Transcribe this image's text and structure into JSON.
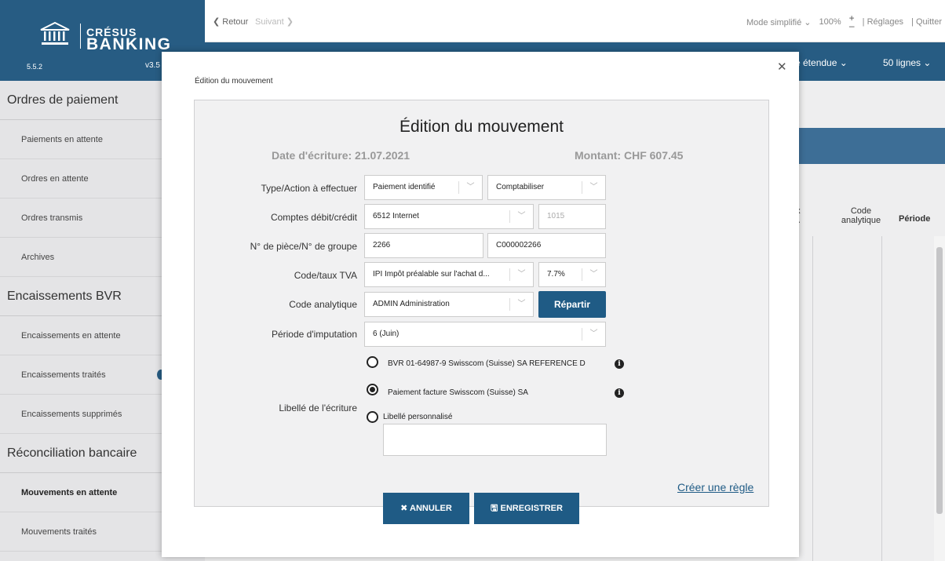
{
  "app": {
    "brand_top": "CRÉSUS",
    "brand_bottom": "BANKING",
    "version_left": "5.5.2",
    "version_right": "v3.5"
  },
  "topbar": {
    "back": "❮ Retour",
    "next": "Suivant ❯",
    "mode": "Mode simplifié ⌄",
    "zoom": "100%",
    "zoom_plus": "+",
    "zoom_minus": "–",
    "settings": "| Réglages",
    "quit": "| Quitter"
  },
  "navband": {
    "view": "e étendue ⌄",
    "lines": "50 lignes ⌄"
  },
  "sidebar": {
    "sections": [
      {
        "title": "Ordres de paiement",
        "items": [
          "Paiements en attente",
          "Ordres en attente",
          "Ordres transmis",
          "Archives"
        ]
      },
      {
        "title": "Encaissements BVR",
        "items": [
          "Encaissements en attente",
          "Encaissements traités",
          "Encaissements supprimés"
        ]
      },
      {
        "title": "Réconciliation bancaire",
        "items": [
          "Mouvements en attente",
          "Mouvements traités"
        ]
      }
    ]
  },
  "table": {
    "col_tva_a": "ux",
    "col_tva_b": "/A",
    "col_code_a": "Code",
    "col_code_b": "analytique",
    "col_period": "Période"
  },
  "modal": {
    "title": "Édition du mouvement",
    "heading": "Édition du mouvement",
    "date": "Date d'écriture: 21.07.2021",
    "amount": "Montant: CHF 607.45",
    "labels": {
      "type": "Type/Action à effectuer",
      "comptes": "Comptes débit/crédit",
      "piece": "N° de pièce/N° de groupe",
      "tva": "Code/taux TVA",
      "analytique": "Code analytique",
      "periode": "Période d'imputation",
      "libelle": "Libellé de l'écriture"
    },
    "fields": {
      "type": "Paiement identifié",
      "action": "Comptabiliser",
      "debit": "6512 Internet",
      "credit": "1015",
      "piece": "2266",
      "groupe": "C000002266",
      "tva_code": "IPI Impôt préalable sur l'achat d...",
      "tva_rate": "7.7%",
      "analytique": "ADMIN Administration",
      "periode": "6 (Juin)"
    },
    "repartir": "Répartir",
    "radios": {
      "r1": "BVR 01-64987-9 Swisscom (Suisse) SA REFERENCE D",
      "r2": "Paiement facture Swisscom (Suisse) SA",
      "r3": "Libellé personnalisé"
    },
    "rule_link": "Créer une règle",
    "cancel": "ANNULER",
    "save": "ENREGISTRER"
  },
  "colors": {
    "brand": "#275c83",
    "button": "#1f5b85"
  }
}
